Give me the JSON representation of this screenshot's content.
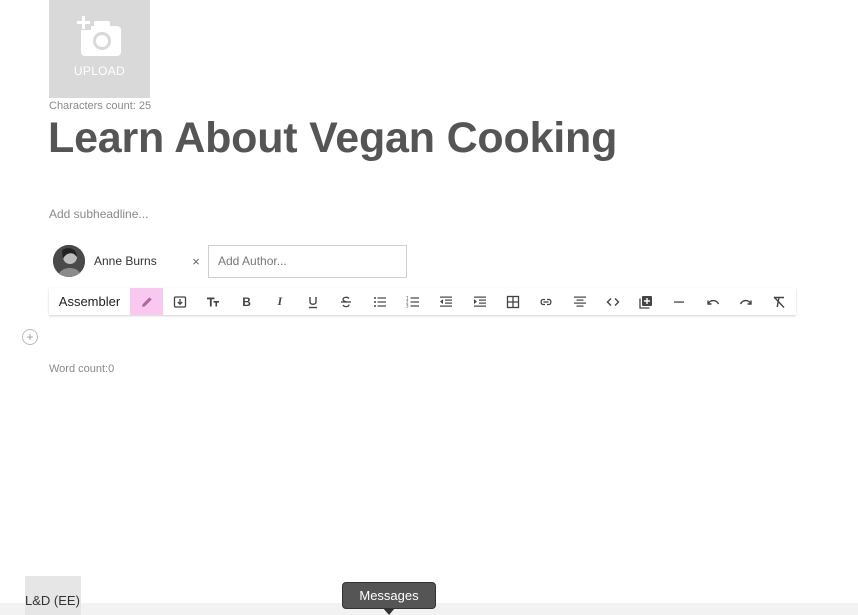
{
  "upload": {
    "label": "UPLOAD"
  },
  "editor": {
    "characters_count": "Characters count: 25",
    "headline": "Learn About Vegan Cooking",
    "subheadline_placeholder": "Add subheadline...",
    "word_count": "Word count:0"
  },
  "authors": {
    "items": [
      {
        "name": "Anne Burns",
        "remove_symbol": "×"
      }
    ],
    "input_placeholder": "Add Author..."
  },
  "toolbar": {
    "mode_label": "Assembler",
    "buttons": [
      {
        "name": "edit-icon",
        "active": true
      },
      {
        "name": "import-icon"
      },
      {
        "name": "text-size-icon"
      },
      {
        "name": "bold-icon"
      },
      {
        "name": "italic-icon"
      },
      {
        "name": "underline-icon"
      },
      {
        "name": "strikethrough-icon"
      },
      {
        "name": "bulleted-list-icon"
      },
      {
        "name": "numbered-list-icon"
      },
      {
        "name": "outdent-icon"
      },
      {
        "name": "indent-icon"
      },
      {
        "name": "table-icon"
      },
      {
        "name": "link-icon"
      },
      {
        "name": "align-center-icon"
      },
      {
        "name": "code-icon"
      },
      {
        "name": "add-media-icon"
      },
      {
        "name": "horizontal-rule-icon"
      },
      {
        "name": "undo-icon"
      },
      {
        "name": "redo-icon"
      },
      {
        "name": "clear-format-icon"
      }
    ],
    "accent_color": "#f8c8f0"
  },
  "add_block": {
    "symbol": "+"
  },
  "footer": {
    "workspace_tab": "L&D (EE)",
    "messages_label": "Messages"
  }
}
